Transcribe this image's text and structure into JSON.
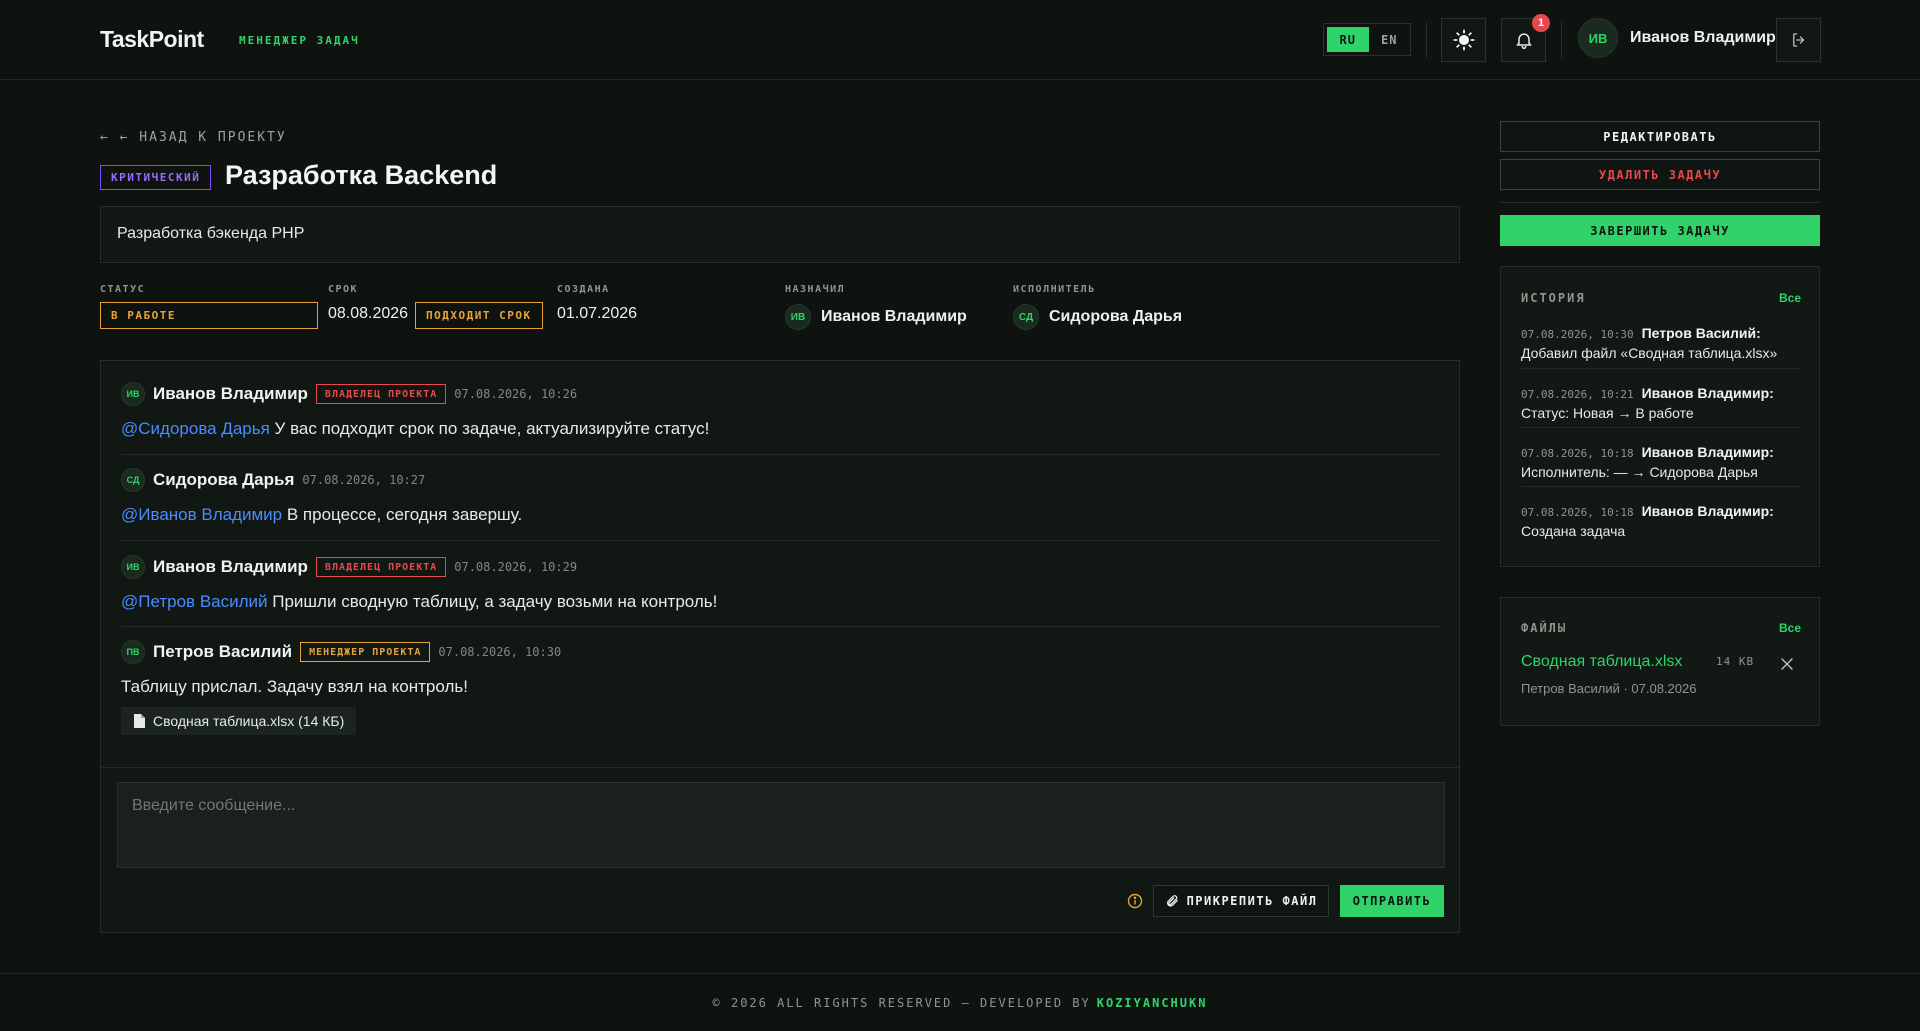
{
  "header": {
    "logo": "TaskPoint",
    "logo_sub": "МЕНЕДЖЕР ЗАДАЧ",
    "lang_ru": "RU",
    "lang_en": "EN",
    "notifications_count": "1",
    "user_initials": "ИВ",
    "user_name": "Иванов Владимир"
  },
  "task": {
    "back_label": "← ← НАЗАД К ПРОЕКТУ",
    "priority": "КРИТИЧЕСКИЙ",
    "title": "Разработка Backend",
    "description": "Разработка бэкенда PHP",
    "status_label": "СТАТУС",
    "status_value": "В РАБОТЕ",
    "due_label": "СРОК",
    "due_value": "08.08.2026",
    "due_badge": "ПОДХОДИТ СРОК",
    "created_label": "СОЗДАНА",
    "created_value": "01.07.2026",
    "assigner_label": "НАЗНАЧИЛ",
    "assigner_initials": "ИВ",
    "assigner_name": "Иванов Владимир",
    "assignee_label": "ИСПОЛНИТЕЛЬ",
    "assignee_initials": "СД",
    "assignee_name": "Сидорова Дарья"
  },
  "chat": {
    "messages": [
      {
        "initials": "ИВ",
        "author": "Иванов Владимир",
        "role": "ВЛАДЕЛЕЦ ПРОЕКТА",
        "time": "07.08.2026, 10:26",
        "mention": "@Сидорова Дарья",
        "text": " У вас подходит срок по задаче, актуализируйте статус!"
      },
      {
        "initials": "СД",
        "author": "Сидорова Дарья",
        "role": "",
        "time": "07.08.2026, 10:27",
        "mention": "@Иванов Владимир",
        "text": " В процессе, сегодня завершу."
      },
      {
        "initials": "ИВ",
        "author": "Иванов Владимир",
        "role": "ВЛАДЕЛЕЦ ПРОЕКТА",
        "time": "07.08.2026, 10:29",
        "mention": "@Петров Василий",
        "text": " Пришли сводную таблицу, а задачу возьми на контроль!"
      },
      {
        "initials": "ПВ",
        "author": "Петров Василий",
        "role": "МЕНЕДЖЕР ПРОЕКТА",
        "time": "07.08.2026, 10:30",
        "mention": "",
        "text": "Таблицу прислал. Задачу взял на контроль!",
        "attachment": "Сводная таблица.xlsx (14 КБ)"
      }
    ],
    "input_placeholder": "Введите сообщение...",
    "attach_label": "ПРИКРЕПИТЬ ФАЙЛ",
    "send_label": "ОТПРАВИТЬ"
  },
  "sidebar": {
    "edit_label": "РЕДАКТИРОВАТЬ",
    "delete_label": "УДАЛИТЬ ЗАДАЧУ",
    "complete_label": "ЗАВЕРШИТЬ ЗАДАЧУ",
    "history_title": "ИСТОРИЯ",
    "history_all": "Все",
    "history": [
      {
        "time": "07.08.2026, 10:30",
        "who": "Петров Василий:",
        "what": "Добавил файл «Сводная таблица.xlsx»"
      },
      {
        "time": "07.08.2026, 10:21",
        "who": "Иванов Владимир:",
        "what": "Статус: Новая → В работе"
      },
      {
        "time": "07.08.2026, 10:18",
        "who": "Иванов Владимир:",
        "what": "Исполнитель: — → Сидорова Дарья"
      },
      {
        "time": "07.08.2026, 10:18",
        "who": "Иванов Владимир:",
        "what": "Создана задача"
      }
    ],
    "files_title": "ФАЙЛЫ",
    "files_all": "Все",
    "file_name": "Сводная таблица.xlsx",
    "file_size": "14 KB",
    "file_meta": "Петров Василий · 07.08.2026"
  },
  "footer": {
    "text": "© 2026 ALL RIGHTS RESERVED — DEVELOPED BY",
    "developer": "KOZIYANCHUKN"
  },
  "colors": {
    "background": "#0e1310",
    "accent": "#2fd36a",
    "danger": "#e5484d",
    "warning": "#e8a23a",
    "priority": "#9b6bff",
    "mention": "#4a8cff"
  }
}
